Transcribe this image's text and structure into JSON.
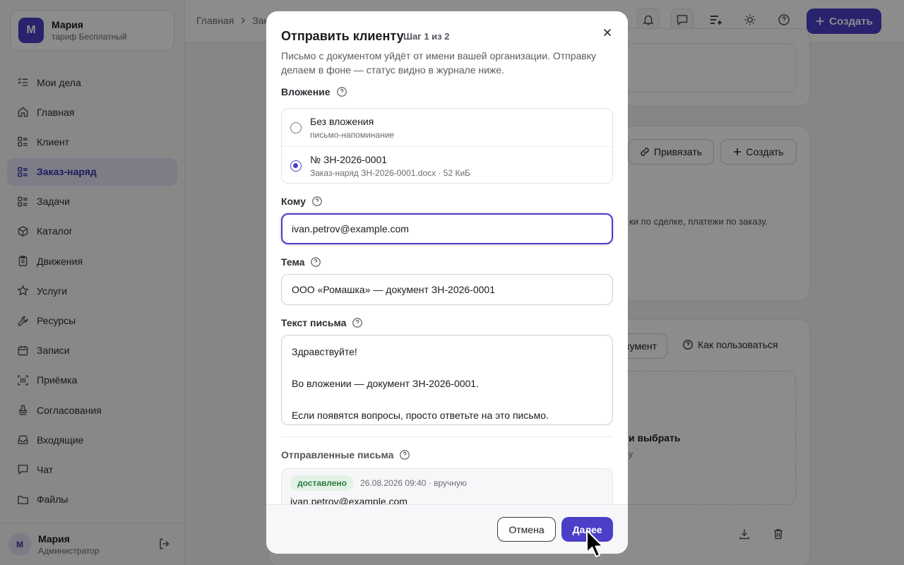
{
  "org": {
    "avatar": "М",
    "name": "Мария",
    "plan": "тариф Бесплатный"
  },
  "nav": [
    {
      "label": "Мои дела",
      "icon": "task-list-icon",
      "active": false
    },
    {
      "label": "Главная",
      "icon": "home-icon",
      "active": false
    },
    {
      "label": "Клиент",
      "icon": "list-icon",
      "active": false
    },
    {
      "label": "Заказ-наряд",
      "icon": "list-icon",
      "active": true
    },
    {
      "label": "Задачи",
      "icon": "list-icon",
      "active": false
    },
    {
      "label": "Каталог",
      "icon": "box-icon",
      "active": false
    },
    {
      "label": "Движения",
      "icon": "clipboard-icon",
      "active": false
    },
    {
      "label": "Услуги",
      "icon": "star-icon",
      "active": false
    },
    {
      "label": "Ресурсы",
      "icon": "wrench-icon",
      "active": false
    },
    {
      "label": "Записи",
      "icon": "calendar-icon",
      "active": false
    },
    {
      "label": "Приёмка",
      "icon": "barcode-icon",
      "active": false
    },
    {
      "label": "Согласования",
      "icon": "stamp-icon",
      "active": false
    },
    {
      "label": "Входящие",
      "icon": "inbox-icon",
      "active": false
    },
    {
      "label": "Чат",
      "icon": "chat-icon",
      "active": false
    },
    {
      "label": "Файлы",
      "icon": "folder-icon",
      "active": false
    }
  ],
  "user": {
    "avatar": "М",
    "name": "Мария",
    "role": "Администратор"
  },
  "topbar": {
    "crumb_home": "Главная",
    "crumb_current": "Зак",
    "create_label": "Создать"
  },
  "background": {
    "link_label": "Привязать",
    "create_label": "Создать",
    "hint_text": "ки по сделке, платежи по заказу.",
    "doc_button_label": "кумент",
    "howto_label": "Как пользоваться",
    "dropzone_text": "и выбрать",
    "dropzone_sub": "у"
  },
  "modal": {
    "title": "Отправить клиенту",
    "step": "Шаг 1 из 2",
    "description": "Письмо с документом уйдёт от имени вашей организации. Отправку делаем в фоне — статус видно в журнале ниже.",
    "attachment_label": "Вложение",
    "attachments": [
      {
        "title": "Без вложения",
        "subtitle": "письмо-напоминание",
        "selected": false
      },
      {
        "title": "№ ЗН-2026-0001",
        "subtitle": "Заказ-наряд ЗН-2026-0001.docx · 52 КиБ",
        "selected": true
      }
    ],
    "to_label": "Кому",
    "to_value": "ivan.petrov@example.com",
    "subject_label": "Тема",
    "subject_value": "ООО «Ромашка» — документ ЗН-2026-0001",
    "body_label": "Текст письма",
    "body_lines": [
      "Здравствуйте!",
      "",
      "Во вложении — документ ЗН-2026-0001.",
      "",
      "Если появятся вопросы, просто ответьте на это письмо."
    ],
    "sent_label": "Отправленные письма",
    "sent": [
      {
        "status": "доставлено",
        "meta": "26.08.2026 09:40 · вручную",
        "to": "ivan.petrov@example.com"
      }
    ],
    "cancel_label": "Отмена",
    "next_label": "Далее"
  },
  "colors": {
    "accent": "#4b3fc7",
    "active_nav_bg": "#e5e3f6",
    "delivered_bg": "#e2f3e6",
    "delivered_text": "#2d7a3e"
  }
}
